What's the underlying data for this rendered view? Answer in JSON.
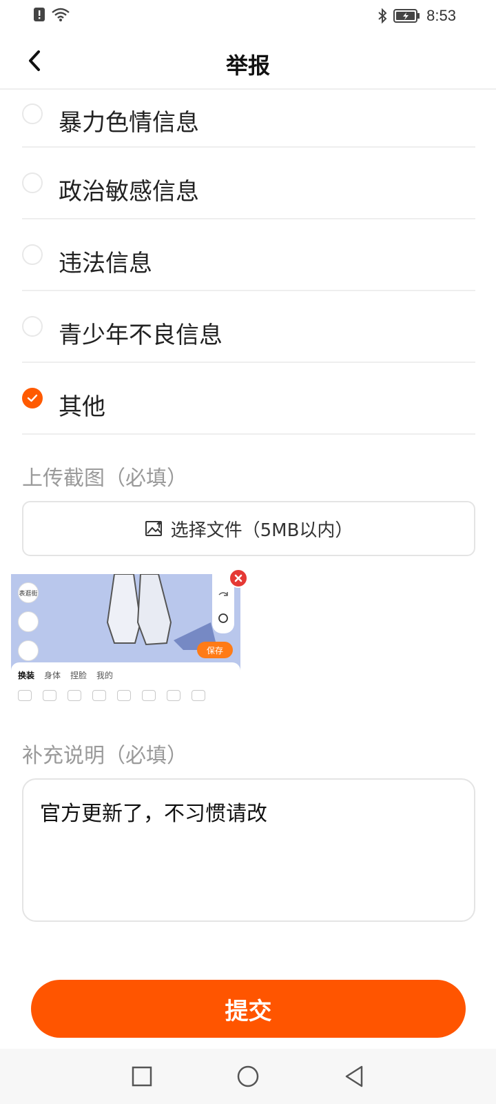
{
  "status_bar": {
    "time": "8:53",
    "icons": [
      "alert-icon",
      "wifi-icon",
      "bluetooth-icon",
      "battery-charging-icon"
    ]
  },
  "header": {
    "title": "举报",
    "back_icon": "back-arrow-icon"
  },
  "options": [
    {
      "label": "暴力色情信息",
      "checked": false
    },
    {
      "label": "政治敏感信息",
      "checked": false
    },
    {
      "label": "违法信息",
      "checked": false
    },
    {
      "label": "青少年不良信息",
      "checked": false
    },
    {
      "label": "其他",
      "checked": true
    }
  ],
  "upload": {
    "label": "上传截图（必填）",
    "button_label": "选择文件（5MB以内）",
    "button_icon": "image-upload-icon"
  },
  "thumbnail": {
    "tabs": [
      "换装",
      "身体",
      "捏脸",
      "我的"
    ],
    "save_label": "保存",
    "side_label": "表逛街"
  },
  "description": {
    "label": "补充说明（必填）",
    "value": "官方更新了，不习惯请改"
  },
  "submit_label": "提交",
  "colors": {
    "accent": "#ff5500",
    "checked": "#ff5a00",
    "divider": "#eeeeee",
    "muted_text": "#9a9a9a"
  },
  "system_nav": [
    "recent-apps-icon",
    "home-icon",
    "back-icon"
  ]
}
